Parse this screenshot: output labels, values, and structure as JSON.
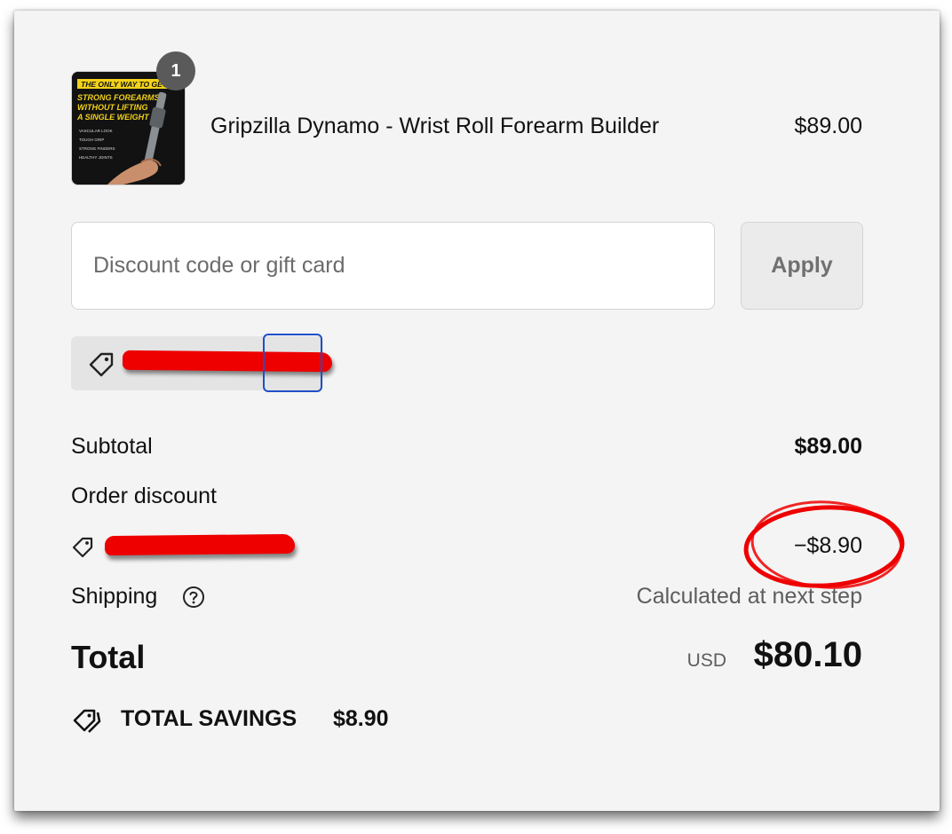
{
  "product": {
    "quantity": "1",
    "name": "Gripzilla Dynamo - Wrist Roll Forearm Builder",
    "price": "$89.00",
    "image": {
      "line1": "THE ONLY WAY TO GET",
      "line2": "STRONG FOREARMS",
      "line3": "WITHOUT LIFTING",
      "line4": "A SINGLE WEIGHT",
      "bullets": [
        "VASCULAR LOOK",
        "TOUGH GRIP",
        "STRONG FINGERS",
        "HEALTHY JOINTS"
      ]
    }
  },
  "discount": {
    "placeholder": "Discount code or gift card",
    "apply_label": "Apply"
  },
  "summary": {
    "subtotal_label": "Subtotal",
    "subtotal_value": "$89.00",
    "order_discount_label": "Order discount",
    "discount_value": "−$8.90",
    "shipping_label": "Shipping",
    "shipping_value": "Calculated at next step",
    "total_label": "Total",
    "currency": "USD",
    "total_value": "$80.10",
    "savings_label": "TOTAL SAVINGS",
    "savings_value": "$8.90"
  },
  "colors": {
    "redaction": "#e00000",
    "focus_ring": "#1f4fc9",
    "page_bg": "#f4f4f4"
  },
  "icons": [
    "tag-icon",
    "help-circle-icon",
    "savings-tag-icon"
  ]
}
